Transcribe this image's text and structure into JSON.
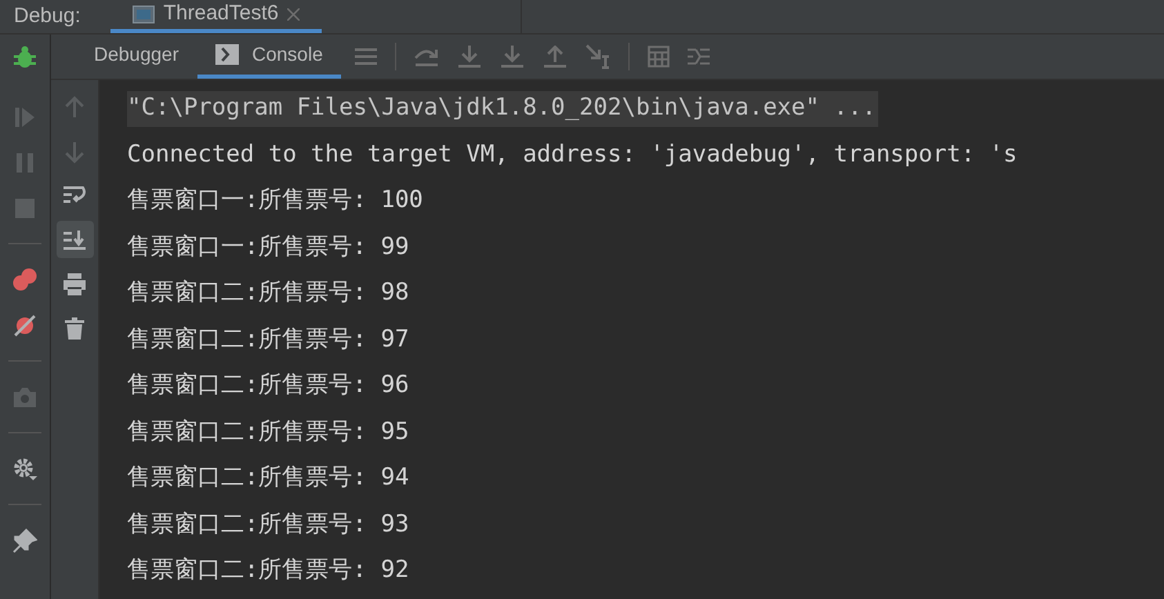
{
  "window": {
    "title": "Debug:"
  },
  "session_tabs": [
    {
      "label": "ThreadTest6",
      "selected": true
    }
  ],
  "tabs": [
    {
      "label": "Debugger",
      "selected": false
    },
    {
      "label": "Console",
      "selected": true
    }
  ],
  "side_tools": [
    {
      "kind": "resume",
      "disabled": true
    },
    {
      "kind": "pause",
      "disabled": true
    },
    {
      "kind": "stop",
      "disabled": true
    },
    {
      "kind": "sep"
    },
    {
      "kind": "breakpoints",
      "disabled": false
    },
    {
      "kind": "mute",
      "disabled": false
    },
    {
      "kind": "sep"
    },
    {
      "kind": "camera",
      "disabled": true
    },
    {
      "kind": "sep"
    },
    {
      "kind": "gear",
      "disabled": false
    },
    {
      "kind": "sep"
    },
    {
      "kind": "pin",
      "disabled": false
    }
  ],
  "console_tools": [
    {
      "kind": "up",
      "disabled": true,
      "selected": false
    },
    {
      "kind": "down",
      "disabled": true,
      "selected": false
    },
    {
      "kind": "wrap",
      "disabled": false,
      "selected": false
    },
    {
      "kind": "scroll-end",
      "disabled": false,
      "selected": true
    },
    {
      "kind": "print",
      "disabled": false,
      "selected": false
    },
    {
      "kind": "trash",
      "disabled": false,
      "selected": false
    }
  ],
  "console_lines": [
    {
      "kind": "command",
      "text": "\"C:\\Program Files\\Java\\jdk1.8.0_202\\bin\\java.exe\" ..."
    },
    {
      "kind": "output",
      "text": "Connected to the target VM, address: 'javadebug', transport: 's"
    },
    {
      "kind": "output",
      "text": "售票窗口一:所售票号: 100"
    },
    {
      "kind": "output",
      "text": "售票窗口一:所售票号: 99"
    },
    {
      "kind": "output",
      "text": "售票窗口二:所售票号: 98"
    },
    {
      "kind": "output",
      "text": "售票窗口二:所售票号: 97"
    },
    {
      "kind": "output",
      "text": "售票窗口二:所售票号: 96"
    },
    {
      "kind": "output",
      "text": "售票窗口二:所售票号: 95"
    },
    {
      "kind": "output",
      "text": "售票窗口二:所售票号: 94"
    },
    {
      "kind": "output",
      "text": "售票窗口二:所售票号: 93"
    },
    {
      "kind": "output",
      "text": "售票窗口二:所售票号: 92"
    }
  ]
}
